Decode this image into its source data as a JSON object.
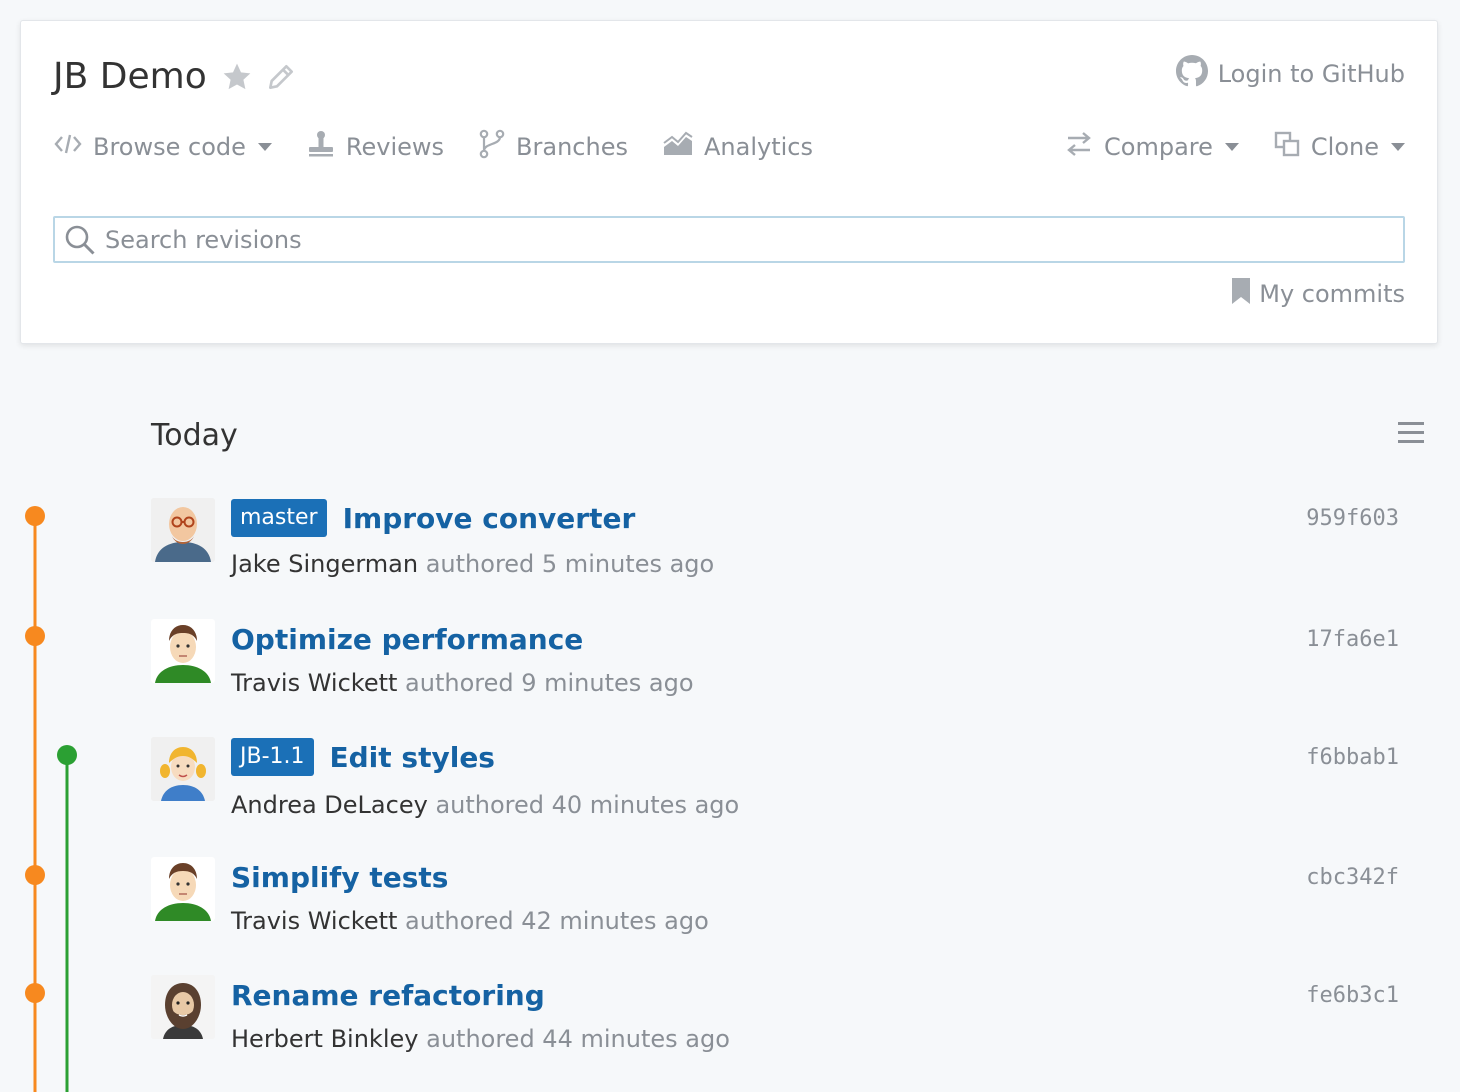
{
  "repo": {
    "title": "JB Demo"
  },
  "header": {
    "login_label": "Login to GitHub"
  },
  "nav": {
    "browse_code": "Browse code",
    "reviews": "Reviews",
    "branches": "Branches",
    "analytics": "Analytics",
    "compare": "Compare",
    "clone": "Clone"
  },
  "search": {
    "placeholder": "Search revisions",
    "value": ""
  },
  "filters": {
    "my_commits": "My commits"
  },
  "timeline": {
    "day_label": "Today"
  },
  "commits": [
    {
      "tag": "master",
      "message": "Improve converter",
      "author": "Jake Singerman",
      "meta": "authored 5 minutes ago",
      "hash": "959f603",
      "avatar_icon": "bald-man-glasses-avatar"
    },
    {
      "tag": "",
      "message": "Optimize performance",
      "author": "Travis Wickett",
      "meta": "authored 9 minutes ago",
      "hash": "17fa6e1",
      "avatar_icon": "man-green-shirt-avatar"
    },
    {
      "tag": "JB-1.1",
      "message": "Edit styles",
      "author": "Andrea DeLacey",
      "meta": "authored 40 minutes ago",
      "hash": "f6bbab1",
      "avatar_icon": "blonde-girl-avatar"
    },
    {
      "tag": "",
      "message": "Simplify tests",
      "author": "Travis Wickett",
      "meta": "authored 42 minutes ago",
      "hash": "cbc342f",
      "avatar_icon": "man-green-shirt-avatar"
    },
    {
      "tag": "",
      "message": "Rename refactoring",
      "author": "Herbert Binkley",
      "meta": "authored 44 minutes ago",
      "hash": "fe6b3c1",
      "avatar_icon": "bearded-man-avatar"
    }
  ],
  "colors": {
    "master_branch": "#f7891f",
    "feature_branch": "#2ba033",
    "tag_bg": "#1b70b7",
    "link": "#1562a3"
  }
}
